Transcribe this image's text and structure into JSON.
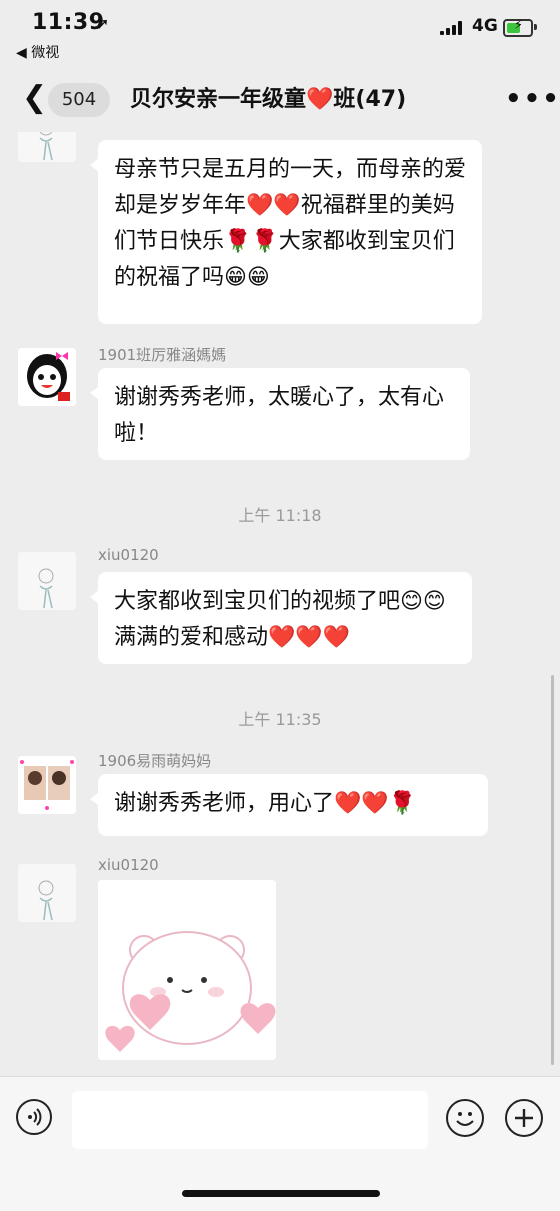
{
  "status_bar": {
    "time": "11:39",
    "back_app": "◀ 微视",
    "network": "4G"
  },
  "nav": {
    "unread_count": "504",
    "title": "贝尔安亲一年级童❤️班(47)"
  },
  "messages": [
    {
      "sender": "",
      "text": "母亲节只是五月的一天，而母亲的爱却是岁岁年年❤️❤️祝福群里的美妈们节日快乐🌹🌹大家都收到宝贝们的祝福了吗😁😁"
    },
    {
      "sender": "1901班厉雅涵媽媽",
      "text": "谢谢秀秀老师，太暖心了，太有心啦！"
    },
    {
      "sender": "xiu0120",
      "text": "大家都收到宝贝们的视频了吧😊😊满满的爱和感动❤️❤️❤️"
    },
    {
      "sender": "1906易雨萌妈妈",
      "text": "谢谢秀秀老师，用心了❤️❤️🌹"
    },
    {
      "sender": "xiu0120",
      "text": ""
    }
  ],
  "timestamps": [
    "上午 11:18",
    "上午 11:35"
  ],
  "icons": {
    "back": "chevron-left-icon",
    "more": "more-icon",
    "voice": "voice-icon",
    "emoji": "emoji-icon",
    "plus": "plus-icon"
  },
  "colors": {
    "background": "#ededed",
    "bubble": "#ffffff",
    "battery": "#3cc43c"
  }
}
